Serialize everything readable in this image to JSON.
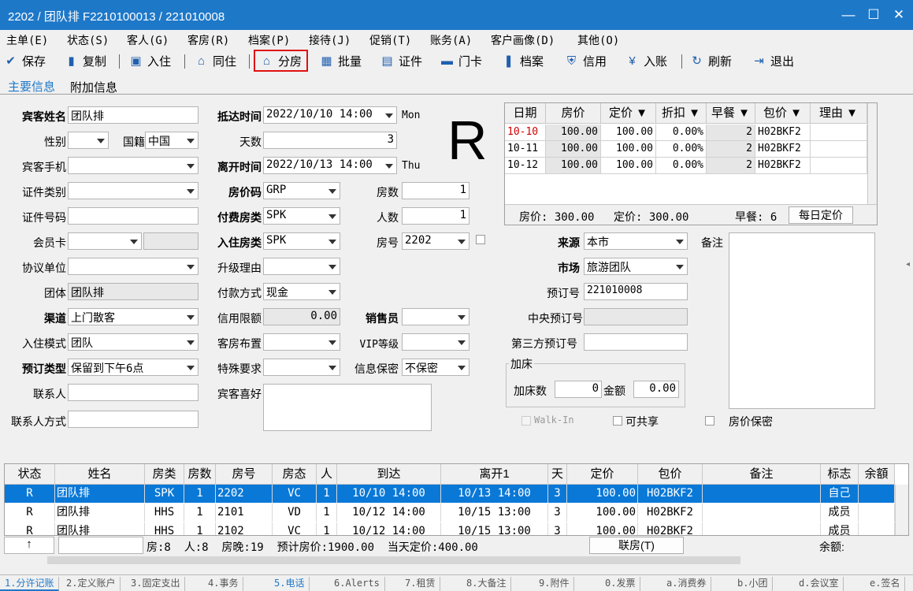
{
  "window": {
    "title": "2202 / 团队排 F2210100013 / 221010008",
    "min": "—",
    "max": "☐",
    "close": "✕"
  },
  "menu": [
    "主单(E)",
    "状态(S)",
    "客人(G)",
    "客房(R)",
    "档案(P)",
    "接待(J)",
    "促销(T)",
    "账务(A)",
    "客户画像(D)",
    "其他(O)"
  ],
  "toolbar": [
    {
      "label": "保存",
      "icon": "check-circle-icon"
    },
    {
      "label": "复制",
      "icon": "copy-icon"
    },
    {
      "label": "入住",
      "icon": "checkin-icon"
    },
    {
      "label": "同住",
      "icon": "share-room-icon"
    },
    {
      "label": "分房",
      "icon": "home-icon"
    },
    {
      "label": "批量",
      "icon": "batch-icon"
    },
    {
      "label": "证件",
      "icon": "id-card-icon"
    },
    {
      "label": "门卡",
      "icon": "card-icon"
    },
    {
      "label": "档案",
      "icon": "profile-icon"
    },
    {
      "label": "信用",
      "icon": "shield-icon"
    },
    {
      "label": "入账",
      "icon": "yen-icon"
    },
    {
      "label": "刷新",
      "icon": "refresh-icon"
    },
    {
      "label": "退出",
      "icon": "exit-icon"
    }
  ],
  "tabs": [
    "主要信息",
    "附加信息"
  ],
  "form": {
    "guest_name_label": "宾客姓名",
    "guest_name": "团队排",
    "gender_label": "性别",
    "gender": "",
    "nationality_label": "国籍",
    "nationality": "中国",
    "phone_label": "宾客手机",
    "phone": "",
    "id_type_label": "证件类别",
    "id_type": "",
    "id_no_label": "证件号码",
    "id_no": "",
    "member_label": "会员卡",
    "member": "",
    "agreement_label": "协议单位",
    "agreement": "",
    "group_label": "团体",
    "group": "团队排",
    "channel_label": "渠道",
    "channel": "上门散客",
    "checkin_mode_label": "入住模式",
    "checkin_mode": "团队",
    "reserve_type_label": "预订类型",
    "reserve_type": "保留到下午6点",
    "contact_label": "联系人",
    "contact": "",
    "contact_method_label": "联系人方式",
    "contact_method": "",
    "arrival_label": "抵达时间",
    "arrival": "2022/10/10 14:00",
    "arrival_dow": "Mon",
    "days_label": "天数",
    "days": "3",
    "departure_label": "离开时间",
    "departure": "2022/10/13 14:00",
    "departure_dow": "Thu",
    "rate_code_label": "房价码",
    "rate_code": "GRP",
    "rooms_label": "房数",
    "rooms": "1",
    "pay_type_label": "付费房类",
    "pay_type": "SPK",
    "persons_label": "人数",
    "persons": "1",
    "checkin_type_label": "入住房类",
    "checkin_type": "SPK",
    "room_no_label": "房号",
    "room_no": "2202",
    "upgrade_label": "升级理由",
    "upgrade": "",
    "payment_label": "付款方式",
    "payment": "现金",
    "credit_label": "信用限额",
    "credit": "0.00",
    "sales_label": "销售员",
    "sales": "",
    "layout_label": "客房布置",
    "layout": "",
    "vip_label": "VIP等级",
    "vip": "",
    "special_label": "特殊要求",
    "special": "",
    "privacy_label": "信息保密",
    "privacy": "不保密",
    "pref_label": "宾客喜好",
    "pref": "",
    "big_letter": "R",
    "source_label": "来源",
    "source": "本市",
    "remark_label": "备注",
    "market_label": "市场",
    "market": "旅游团队",
    "booking_no_label": "预订号",
    "booking_no": "221010008",
    "central_label": "中央预订号",
    "central": "",
    "third_label": "第三方预订号",
    "third": "",
    "extra_bed_group": "加床",
    "extra_bed_label": "加床数",
    "extra_bed": "0",
    "amount_label": "金额",
    "amount": "0.00",
    "walkin_label": "Walk-In",
    "shareable_label": "可共享",
    "rate_secret_label": "房价保密"
  },
  "rate_grid": {
    "headers": [
      "日期",
      "房价",
      "定价 ▼",
      "折扣 ▼",
      "早餐 ▼",
      "包价 ▼",
      "理由 ▼"
    ],
    "rows": [
      [
        "10-10",
        "100.00",
        "100.00",
        "0.00%",
        "2",
        "H02BKF2",
        ""
      ],
      [
        "10-11",
        "100.00",
        "100.00",
        "0.00%",
        "2",
        "H02BKF2",
        ""
      ],
      [
        "10-12",
        "100.00",
        "100.00",
        "0.00%",
        "2",
        "H02BKF2",
        ""
      ]
    ],
    "summary_rate": "房价: 300.00",
    "summary_price": "定价: 300.00",
    "summary_breakfast": "早餐: 6",
    "daily_button": "每日定价"
  },
  "list": {
    "headers": [
      "状态",
      "姓名",
      "房类",
      "房数",
      "房号",
      "房态",
      "人",
      "到达",
      "离开1",
      "天",
      "定价",
      "包价",
      "备注",
      "标志",
      "余額"
    ],
    "rows": [
      [
        "R",
        "团队排",
        "SPK",
        "1",
        "2202",
        "VC",
        "1",
        "10/10 14:00",
        "10/13 14:00",
        "3",
        "100.00",
        "H02BKF2",
        "",
        "自己",
        ""
      ],
      [
        "R",
        "团队排",
        "HHS",
        "1",
        "2101",
        "VD",
        "1",
        "10/12 14:00",
        "10/15 13:00",
        "3",
        "100.00",
        "H02BKF2",
        "",
        "成员",
        ""
      ],
      [
        "R",
        "团队排",
        "HHS",
        "1",
        "2102",
        "VC",
        "1",
        "10/12 14:00",
        "10/15 13:00",
        "3",
        "100.00",
        "H02BKF2",
        "",
        "成员",
        ""
      ]
    ]
  },
  "status": {
    "arrow": "↑",
    "summary": "房:8  人:8  房晚:19  预计房价:1900.00  当天定价:400.00",
    "link_button": "联房(T)",
    "balance": "余额:"
  },
  "bottom_tabs": [
    "1.分许记账",
    "2.定义账户",
    "3.固定支出",
    "4.事务",
    "5.电话",
    "6.Alerts",
    "7.租赁",
    "8.大备注",
    "9.附件",
    "0.发票",
    "a.消费券",
    "b.小团",
    "d.会议室",
    "e.签名"
  ]
}
